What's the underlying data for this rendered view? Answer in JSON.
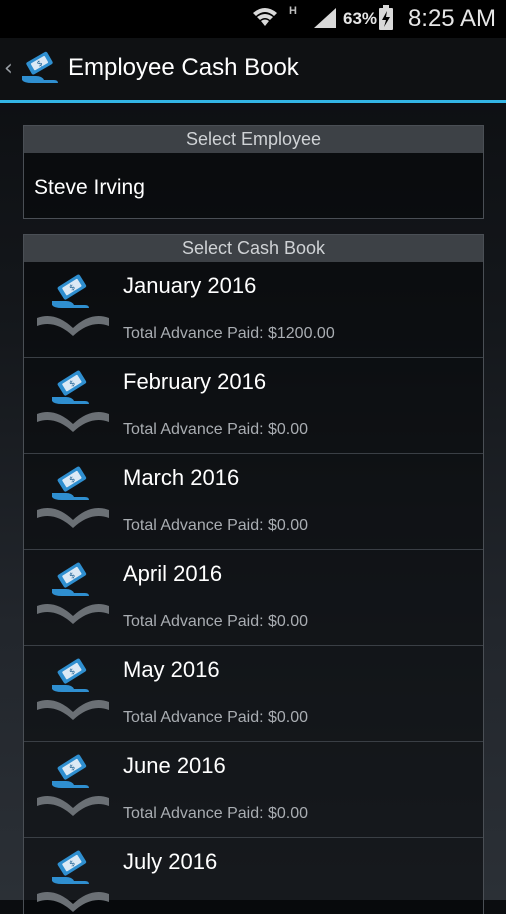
{
  "status_bar": {
    "battery_percent": "63%",
    "time": "8:25 AM",
    "network_type": "H",
    "icons": [
      "wifi-icon",
      "signal-icon",
      "battery-charging-icon"
    ]
  },
  "action_bar": {
    "title": "Employee Cash Book",
    "icons": [
      "back-chevron-icon",
      "cash-book-app-icon"
    ],
    "back_glyph": "‹"
  },
  "employee_section": {
    "header": "Select Employee",
    "selected_employee": "Steve Irving"
  },
  "cashbook_section": {
    "header": "Select Cash Book",
    "items": [
      {
        "month": "January 2016",
        "total": "Total Advance Paid: $1200.00",
        "icon": "cash-book-icon"
      },
      {
        "month": "February 2016",
        "total": "Total Advance Paid: $0.00",
        "icon": "cash-book-icon"
      },
      {
        "month": "March 2016",
        "total": "Total Advance Paid: $0.00",
        "icon": "cash-book-icon"
      },
      {
        "month": "April 2016",
        "total": "Total Advance Paid: $0.00",
        "icon": "cash-book-icon"
      },
      {
        "month": "May 2016",
        "total": "Total Advance Paid: $0.00",
        "icon": "cash-book-icon"
      },
      {
        "month": "June 2016",
        "total": "Total Advance Paid: $0.00",
        "icon": "cash-book-icon"
      },
      {
        "month": "July 2016",
        "total": "",
        "icon": "cash-book-icon"
      }
    ]
  },
  "colors": {
    "accent": "#33b5e5",
    "icon_blue": "#2f8fd0",
    "icon_book": "#6b7075",
    "panel_header_bg": "#3d4146"
  }
}
